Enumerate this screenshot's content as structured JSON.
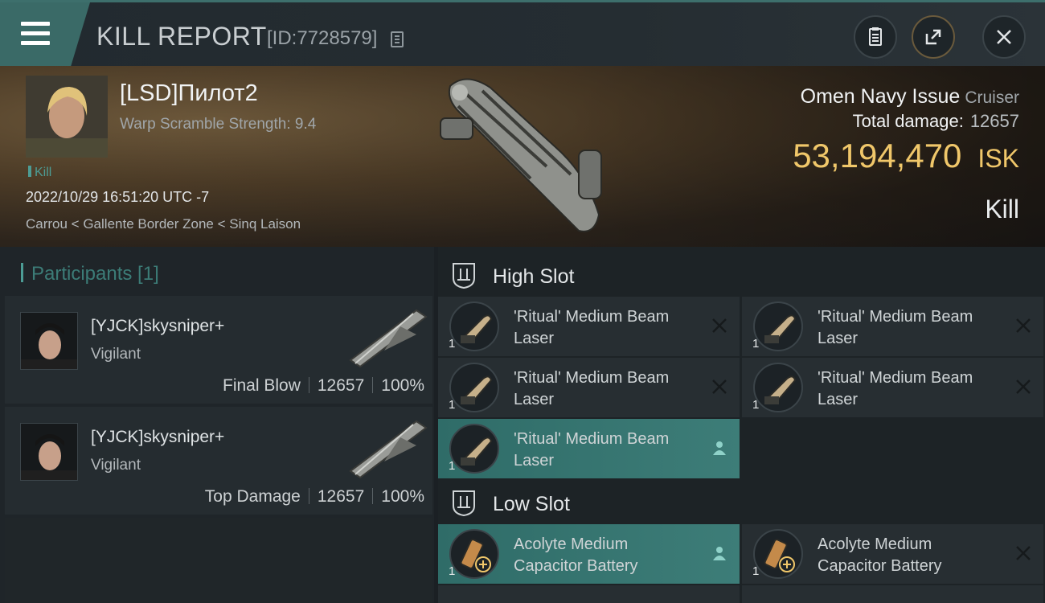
{
  "header": {
    "title": "KILL REPORT",
    "report_id": "[ID:7728579]",
    "icons": [
      "menu-icon",
      "copy-icon",
      "clipboard-icon",
      "share-icon",
      "close-icon"
    ]
  },
  "victim": {
    "name": "[LSD]Пилот2",
    "detail": "Warp Scramble Strength: 9.4",
    "tag": "Kill",
    "datetime": "2022/10/29 16:51:20 UTC -7",
    "location": "Carrou < Gallente Border Zone < Sinq Laison"
  },
  "ship": {
    "name": "Omen Navy Issue",
    "class": "Cruiser",
    "total_damage_label": "Total damage:",
    "total_damage_value": "12657",
    "isk_value": "53,194,470",
    "isk_unit": "ISK",
    "result": "Kill"
  },
  "participants": {
    "label": "Participants [1]",
    "items": [
      {
        "name": "[YJCK]skysniper+",
        "ship": "Vigilant",
        "role": "Final Blow",
        "damage": "12657",
        "percent": "100%"
      },
      {
        "name": "[YJCK]skysniper+",
        "ship": "Vigilant",
        "role": "Top Damage",
        "damage": "12657",
        "percent": "100%"
      }
    ]
  },
  "slots": {
    "high": {
      "label": "High Slot",
      "modules": [
        {
          "qty": "1",
          "name": "'Ritual' Medium Beam Laser",
          "status": "destroyed-icon"
        },
        {
          "qty": "1",
          "name": "'Ritual' Medium Beam Laser",
          "status": "destroyed-icon"
        },
        {
          "qty": "1",
          "name": "'Ritual' Medium Beam Laser",
          "status": "destroyed-icon"
        },
        {
          "qty": "1",
          "name": "'Ritual' Medium Beam Laser",
          "status": "destroyed-icon"
        },
        {
          "qty": "1",
          "name": "'Ritual' Medium Beam Laser",
          "status": "dropped-icon"
        }
      ]
    },
    "low": {
      "label": "Low Slot",
      "modules": [
        {
          "qty": "1",
          "name": "Acolyte Medium Capacitor Battery",
          "status": "dropped-icon"
        },
        {
          "qty": "1",
          "name": "Acolyte Medium Capacitor Battery",
          "status": "destroyed-icon"
        }
      ]
    }
  },
  "colors": {
    "accent": "#3d7d78",
    "isk": "#f0c76a",
    "background": "#1b2024"
  }
}
